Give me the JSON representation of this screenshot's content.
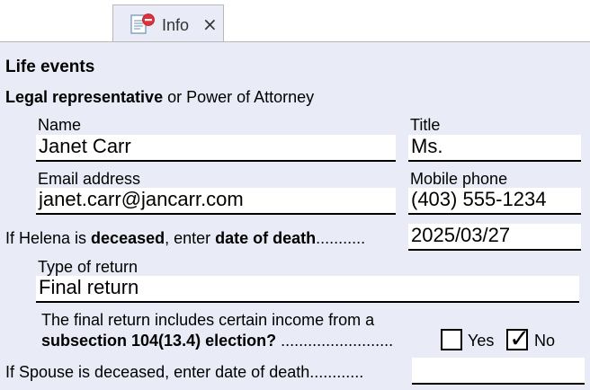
{
  "tab": {
    "label": "Info",
    "close": "×"
  },
  "section": {
    "title": "Life events"
  },
  "representative": {
    "heading_bold": "Legal representative",
    "heading_rest": " or Power of Attorney",
    "name_label": "Name",
    "name_value": "Janet Carr",
    "title_label": "Title",
    "title_value": "Ms.",
    "email_label": "Email address",
    "email_value": "janet.carr@jancarr.com",
    "phone_label": "Mobile phone",
    "phone_value": "(403) 555-1234"
  },
  "death": {
    "prefix": "If Helena is ",
    "bold1": "deceased",
    "middle": ", enter ",
    "bold2": "date of death",
    "dots": "...........",
    "date_value": "2025/03/27"
  },
  "return": {
    "type_label": "Type of return",
    "type_value": "Final return",
    "question_line1": "The final return includes certain income from a",
    "question_bold": "subsection 104(13.4) election?",
    "question_dots": " .........................",
    "yes_label": "Yes",
    "no_label": "No",
    "yes_checked": false,
    "no_checked": true,
    "check_glyph": "✓"
  },
  "spouse": {
    "label": "If Spouse is deceased, enter date of death",
    "dots": "............",
    "date_value": ""
  }
}
